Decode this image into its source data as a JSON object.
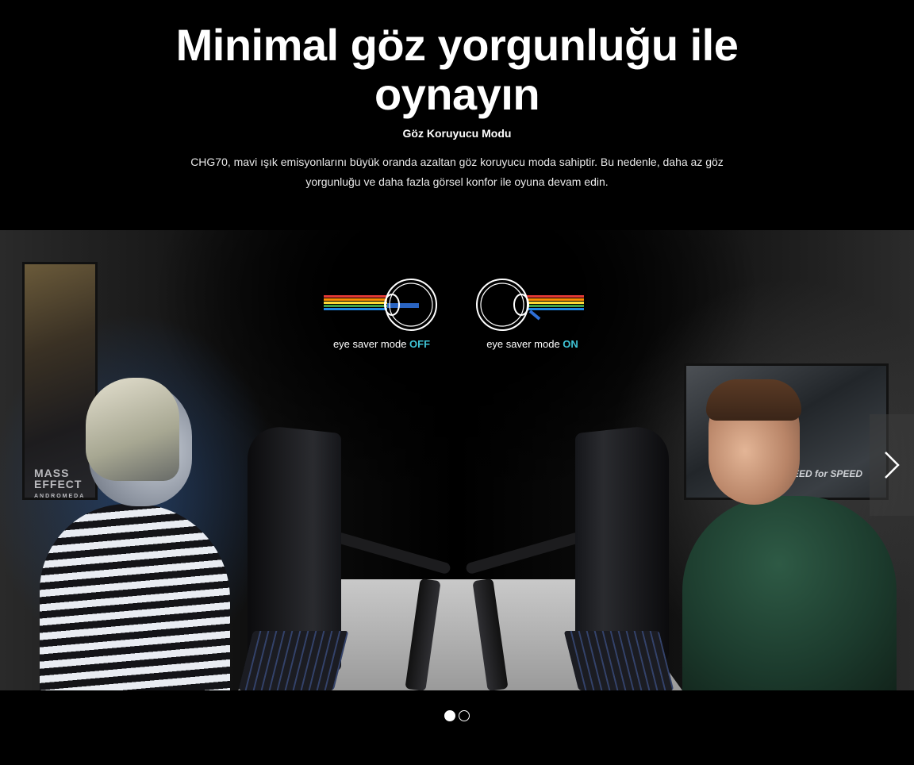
{
  "headline": {
    "line1": "Minimal göz yorgunluğu ile",
    "line2": "oynayın"
  },
  "subtitle": "Göz Koruyucu Modu",
  "description": "CHG70, mavi ışık emisyonlarını büyük oranda azaltan göz koruyucu moda sahiptir. Bu nedenle, daha az göz yorgunluğu ve daha fazla görsel konfor ile oyuna devam edin.",
  "eye_saver": {
    "off": {
      "prefix": "eye saver mode ",
      "state": "OFF"
    },
    "on": {
      "prefix": "eye saver mode ",
      "state": "ON"
    },
    "state_color": "#3fc4d6"
  },
  "posters": {
    "left": "MASS EFFECT",
    "left_sub": "ANDROMEDA",
    "right": "NEED for SPEED"
  },
  "carousel": {
    "slide_count": 2,
    "active_slide": 1
  },
  "icons": {
    "next": "chevron-right-icon"
  }
}
